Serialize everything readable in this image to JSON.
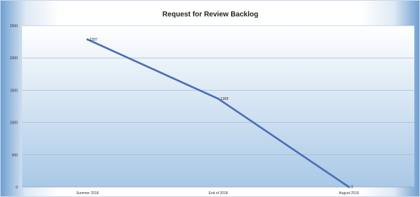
{
  "chart_data": {
    "type": "line",
    "title": "Request for Review Backlog",
    "xlabel": "",
    "ylabel": "",
    "categories": [
      "Summer 2018",
      "End of 2018",
      "August 2019"
    ],
    "series": [
      {
        "values": [
          2287,
          1368,
          0
        ],
        "color": "#4a6fb5",
        "data_labels": [
          "2287",
          "1368",
          "0"
        ]
      }
    ],
    "ylim": [
      0,
      2500
    ],
    "yticks": [
      0,
      500,
      1000,
      1500,
      2000,
      2500
    ],
    "grid": true,
    "legend": "none",
    "colors": {
      "plot_background": "#d2e4f3",
      "gridline": "#9ab4cf",
      "line": "#4a6fb5"
    }
  }
}
